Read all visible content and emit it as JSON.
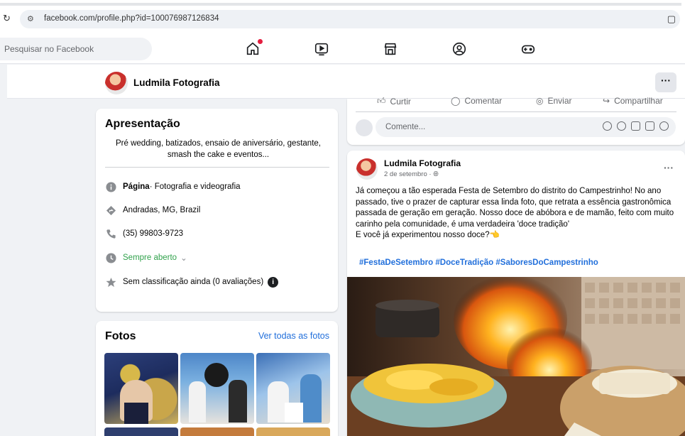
{
  "browser": {
    "url": "facebook.com/profile.php?id=100076987126834"
  },
  "nav": {
    "search_placeholder": "Pesquisar no Facebook",
    "icons": [
      "home-icon",
      "video-icon",
      "marketplace-icon",
      "groups-icon",
      "gaming-icon"
    ],
    "accent": "#e41e3f"
  },
  "profile": {
    "name": "Ludmila Fotografia",
    "more": "···"
  },
  "intro": {
    "title": "Apresentação",
    "bio": "Pré wedding, batizados, ensaio de aniversário, gestante, smash the cake e eventos...",
    "page_label": "Página",
    "page_category": " · Fotografia e videografia",
    "location": "Andradas, MG, Brazil",
    "phone": "(35) 99803-9723",
    "hours": "Sempre aberto",
    "hours_chevron": "⌄",
    "rating": "Sem classificação ainda (0 avaliações)",
    "info_badge": "i"
  },
  "photos": {
    "title": "Fotos",
    "see_all": "Ver todas as fotos"
  },
  "post_actions": {
    "like": "Curtir",
    "comment": "Comentar",
    "send": "Enviar",
    "share": "Compartilhar",
    "comment_placeholder": "Comente..."
  },
  "post": {
    "author": "Ludmila Fotografia",
    "date": "2 de setembro",
    "date_separator": " · ",
    "more": "···",
    "text_line1": "Já começou a tão esperada Festa de Setembro do distrito do Campestrinho! No ano passado, tive o prazer de capturar essa linda foto, que retrata a essência gastronômica passada de geração em geração. Nosso doce de abóbora e de mamão, feito com muito carinho pela comunidade, é uma verdadeira 'doce tradição'",
    "text_line2": "E você já experimentou nosso doce?",
    "emoji": "👈",
    "hashtags": "#FestaDeSetembro #DoceTradição #SaboresDoCampestrinho"
  },
  "colors": {
    "link": "#216fdb",
    "green": "#31a24c",
    "background": "#f0f2f5"
  }
}
